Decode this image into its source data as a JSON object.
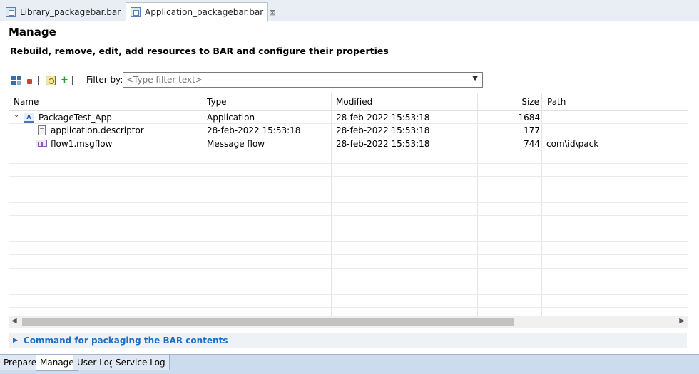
{
  "editor_tabs": [
    {
      "label": "Library_packagebar.bar",
      "active": false
    },
    {
      "label": "Application_packagebar.bar",
      "active": true,
      "close": "⊠"
    }
  ],
  "form": {
    "title": "Manage",
    "subtitle": "Rebuild, remove, edit, add resources to BAR and configure their properties"
  },
  "toolbar": {
    "icons": [
      "rebuild-icon",
      "remove-icon",
      "edit-icon",
      "add-icon"
    ],
    "filter_label": "Filter by:",
    "filter_placeholder": "<Type filter text>",
    "filter_arrow": "▼"
  },
  "table": {
    "columns": [
      "Name",
      "Type",
      "Modified",
      "Size",
      "Path"
    ],
    "rows": [
      {
        "name": "PackageTest_App",
        "type": "Application",
        "modified": "28-feb-2022  15:53:18",
        "size": "1684",
        "path": "",
        "twisty": "⌄",
        "icon": "A"
      },
      {
        "name": "application.descriptor",
        "type": "28-feb-2022  15:53:18",
        "modified": "28-feb-2022  15:53:18",
        "size": "177",
        "path": ""
      },
      {
        "name": "flow1.msgflow",
        "type": "Message flow",
        "modified": "28-feb-2022  15:53:18",
        "size": "744",
        "path": "com\\id\\pack"
      }
    ],
    "scroll_left": "◀",
    "scroll_right": "▶"
  },
  "command_section": {
    "twisty": "▶",
    "label": "Command for packaging the BAR contents"
  },
  "page_tabs": [
    {
      "label": "Prepare",
      "active": false
    },
    {
      "label": "Manage",
      "active": true
    },
    {
      "label": "User Log",
      "active": false
    },
    {
      "label": "Service Log",
      "active": false
    }
  ]
}
